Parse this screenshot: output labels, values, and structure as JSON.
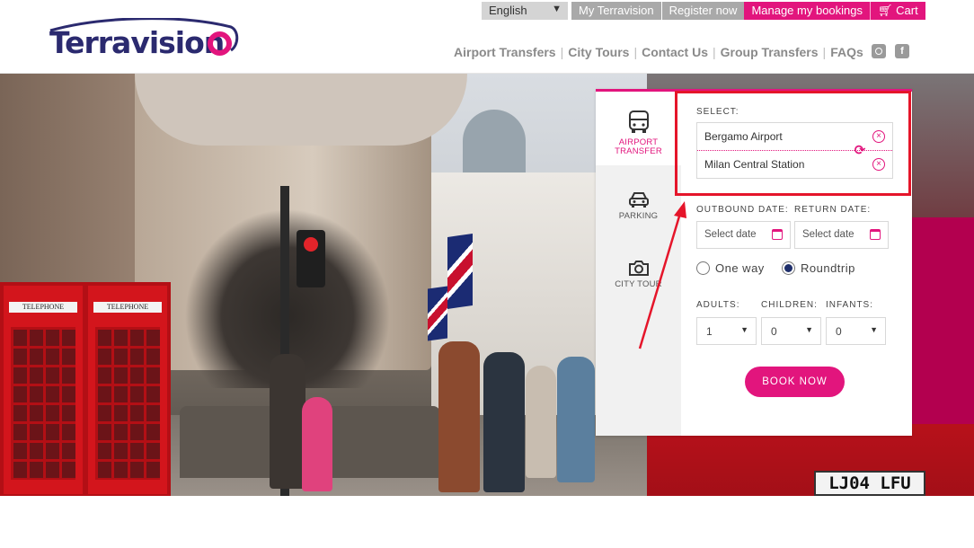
{
  "brand": {
    "logo_text": "Terravision",
    "accent": "#e2157d",
    "navy": "#2b2a6f"
  },
  "topbar": {
    "language": "English",
    "links": [
      "My Terravision",
      "Register now"
    ],
    "manage": "Manage my bookings",
    "cart": "Cart"
  },
  "nav": [
    "Airport Transfers",
    "City Tours",
    "Contact Us",
    "Group Transfers",
    "FAQs"
  ],
  "social": [
    "instagram-icon",
    "facebook-icon"
  ],
  "hero": {
    "plate": "LJ04 LFU",
    "booth_sign": "TELEPHONE"
  },
  "panel": {
    "tabs": [
      {
        "label_line1": "AIRPORT",
        "label_line2": "TRANSFER",
        "icon": "bus-icon"
      },
      {
        "label": "PARKING",
        "icon": "car-icon"
      },
      {
        "label": "CITY TOUR",
        "icon": "camera-icon"
      }
    ],
    "select_label": "SELECT:",
    "from_value": "Bergamo Airport",
    "to_value": "Milan Central Station",
    "outbound_label": "OUTBOUND DATE:",
    "return_label": "RETURN DATE:",
    "outbound_placeholder": "Select date",
    "return_placeholder": "Select date",
    "one_way": "One way",
    "roundtrip": "Roundtrip",
    "adults_label": "ADULTS:",
    "children_label": "CHILDREN:",
    "infants_label": "INFANTS:",
    "adults_value": "1",
    "children_value": "0",
    "infants_value": "0",
    "book_now": "BOOK NOW"
  }
}
